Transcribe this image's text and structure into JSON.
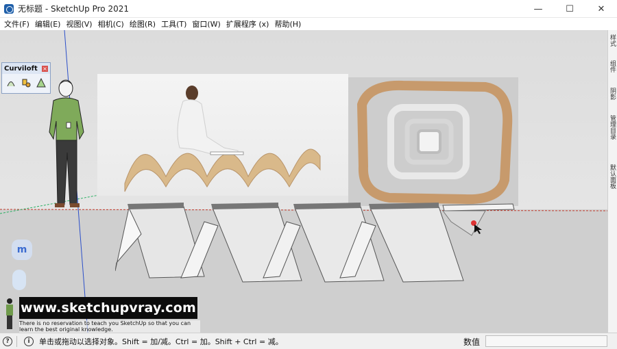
{
  "window": {
    "title": "无标题 - SketchUp Pro 2021",
    "controls": {
      "minimize": "—",
      "maximize": "☐",
      "close": "✕"
    }
  },
  "menu": [
    {
      "label": "文件(F)"
    },
    {
      "label": "编辑(E)"
    },
    {
      "label": "视图(V)"
    },
    {
      "label": "相机(C)"
    },
    {
      "label": "绘图(R)"
    },
    {
      "label": "工具(T)"
    },
    {
      "label": "窗口(W)"
    },
    {
      "label": "扩展程序 (x)"
    },
    {
      "label": "帮助(H)"
    }
  ],
  "right_tray_tabs": [
    "样式",
    "组件",
    "阴影",
    "管理目录",
    "默认面板"
  ],
  "curviloft": {
    "title": "Curviloft",
    "close_glyph": "×",
    "tools": [
      "loft-by-spline-icon",
      "loft-along-path-icon",
      "skinning-icon"
    ]
  },
  "float_panel": {
    "label": "m"
  },
  "overlay": {
    "website": "www.sketchupvray.com",
    "note": "There is no reservation to teach you SketchUp so that you can learn the best original knowledge."
  },
  "status": {
    "hint": "单击或拖动以选择对象。Shift = 加/减。Ctrl = 加。Shift + Ctrl = 减。",
    "measurements_label": "数值",
    "measurements_value": ""
  },
  "colors": {
    "accent_blue": "#2b4fc9",
    "axis_red": "#c0392b",
    "axis_green": "#27ae60"
  }
}
